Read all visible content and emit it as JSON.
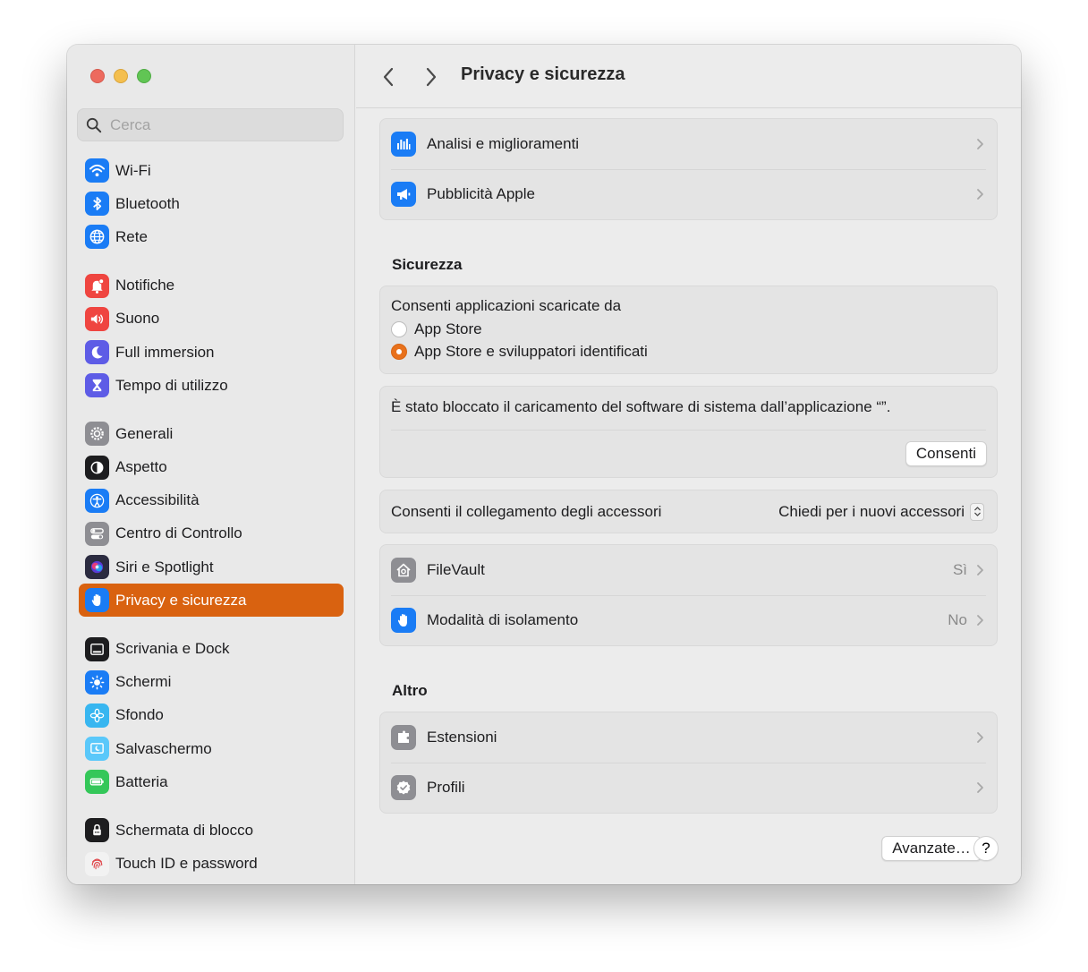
{
  "window": {
    "title": "Privacy e sicurezza"
  },
  "search": {
    "placeholder": "Cerca"
  },
  "sidebar": {
    "groups": [
      [
        {
          "label": "Wi-Fi",
          "icon": "wifi-icon",
          "color": "#1a7cf5"
        },
        {
          "label": "Bluetooth",
          "icon": "bluetooth-icon",
          "color": "#1a7cf5"
        },
        {
          "label": "Rete",
          "icon": "globe-icon",
          "color": "#1a7cf5"
        }
      ],
      [
        {
          "label": "Notifiche",
          "icon": "bell-icon",
          "color": "#ef4540"
        },
        {
          "label": "Suono",
          "icon": "speaker-icon",
          "color": "#ef4540"
        },
        {
          "label": "Full immersion",
          "icon": "moon-icon",
          "color": "#5e5ce6"
        },
        {
          "label": "Tempo di utilizzo",
          "icon": "hourglass-icon",
          "color": "#5e5ce6"
        }
      ],
      [
        {
          "label": "Generali",
          "icon": "gear-icon",
          "color": "#8e8e93"
        },
        {
          "label": "Aspetto",
          "icon": "appearance-icon",
          "color": "#1d1d1f"
        },
        {
          "label": "Accessibilità",
          "icon": "accessibility-icon",
          "color": "#1a7cf5"
        },
        {
          "label": "Centro di Controllo",
          "icon": "control-center-icon",
          "color": "#8e8e93"
        },
        {
          "label": "Siri e Spotlight",
          "icon": "siri-icon",
          "color": "#2b2b40"
        },
        {
          "label": "Privacy e sicurezza",
          "icon": "hand-icon",
          "color": "#1a7cf5",
          "active": true
        }
      ],
      [
        {
          "label": "Scrivania e Dock",
          "icon": "dock-icon",
          "color": "#1d1d1f"
        },
        {
          "label": "Schermi",
          "icon": "sun-icon",
          "color": "#1a7cf5"
        },
        {
          "label": "Sfondo",
          "icon": "flower-icon",
          "color": "#38b6f0"
        },
        {
          "label": "Salvaschermo",
          "icon": "screensaver-icon",
          "color": "#5ac8fa"
        },
        {
          "label": "Batteria",
          "icon": "battery-icon",
          "color": "#34c759"
        }
      ],
      [
        {
          "label": "Schermata di blocco",
          "icon": "lock-icon",
          "color": "#1d1d1f"
        },
        {
          "label": "Touch ID e password",
          "icon": "fingerprint-icon",
          "color": "#f2f2f2"
        }
      ]
    ]
  },
  "privacy": {
    "analytics": {
      "label": "Analisi e miglioramenti",
      "icon": "chart-icon",
      "color": "#1a7cf5"
    },
    "ads": {
      "label": "Pubblicità Apple",
      "icon": "megaphone-icon",
      "color": "#1a7cf5"
    }
  },
  "security": {
    "title": "Sicurezza",
    "allow_apps_label": "Consenti applicazioni scaricate da",
    "option_app_store": "App Store",
    "option_identified": "App Store e sviluppatori identificati",
    "selected": "App Store e sviluppatori identificati",
    "blocked_message": "È stato bloccato il caricamento del software di sistema dall’applicazione “”.",
    "allow_button": "Consenti",
    "accessories_label": "Consenti il collegamento degli accessori",
    "accessories_value": "Chiedi per i nuovi accessori",
    "filevault": {
      "label": "FileVault",
      "value": "Sì",
      "icon": "house-lock-icon",
      "color": "#8e8e93"
    },
    "lockdown": {
      "label": "Modalità di isolamento",
      "value": "No",
      "icon": "hand-icon",
      "color": "#1a7cf5"
    }
  },
  "other": {
    "title": "Altro",
    "extensions": {
      "label": "Estensioni",
      "icon": "puzzle-icon",
      "color": "#8e8e93"
    },
    "profiles": {
      "label": "Profili",
      "icon": "checkmark-seal-icon",
      "color": "#8e8e93"
    }
  },
  "footer": {
    "advanced_button": "Avanzate…",
    "help_button": "?"
  },
  "accent": "#d96210"
}
